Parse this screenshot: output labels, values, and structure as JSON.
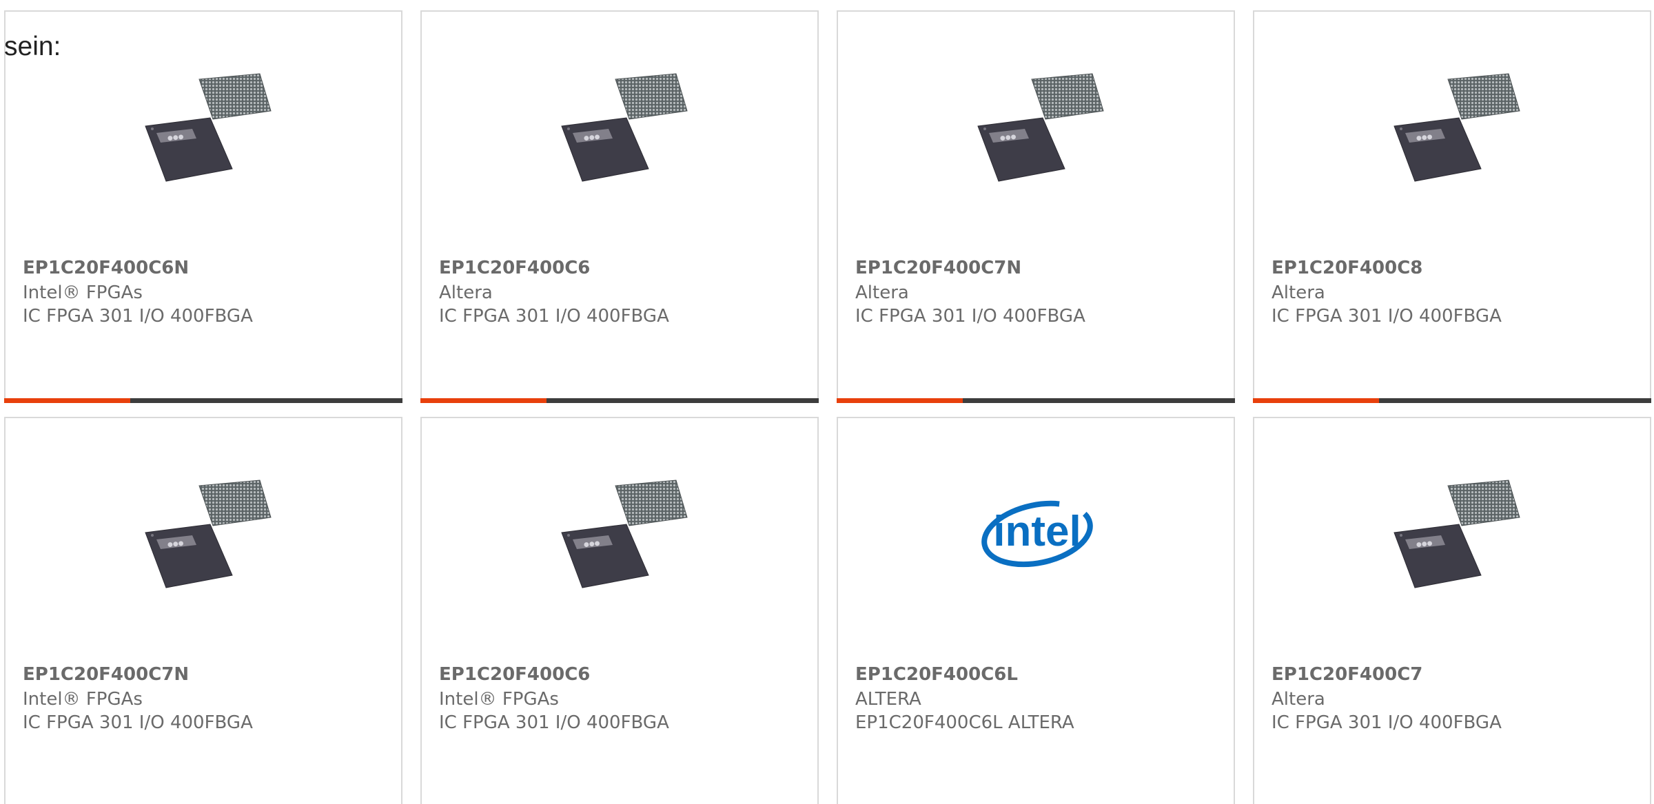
{
  "intro_text": "sein:",
  "accent_color": "#e8400c",
  "products": [
    {
      "part_number": "EP1C20F400C6N",
      "manufacturer": "Intel® FPGAs",
      "description": "IC FPGA 301 I/O 400FBGA",
      "image": "fpga-chip-icon"
    },
    {
      "part_number": "EP1C20F400C6",
      "manufacturer": "Altera",
      "description": "IC FPGA 301 I/O 400FBGA",
      "image": "fpga-chip-icon"
    },
    {
      "part_number": "EP1C20F400C7N",
      "manufacturer": "Altera",
      "description": "IC FPGA 301 I/O 400FBGA",
      "image": "fpga-chip-icon"
    },
    {
      "part_number": "EP1C20F400C8",
      "manufacturer": "Altera",
      "description": "IC FPGA 301 I/O 400FBGA",
      "image": "fpga-chip-icon"
    },
    {
      "part_number": "EP1C20F400C7N",
      "manufacturer": "Intel® FPGAs",
      "description": "IC FPGA 301 I/O 400FBGA",
      "image": "fpga-chip-icon"
    },
    {
      "part_number": "EP1C20F400C6",
      "manufacturer": "Intel® FPGAs",
      "description": "IC FPGA 301 I/O 400FBGA",
      "image": "fpga-chip-icon"
    },
    {
      "part_number": "EP1C20F400C6L",
      "manufacturer": "ALTERA",
      "description": "EP1C20F400C6L ALTERA",
      "image": "intel-logo",
      "logo_text": "intel"
    },
    {
      "part_number": "EP1C20F400C7",
      "manufacturer": "Altera",
      "description": "IC FPGA 301 I/O 400FBGA",
      "image": "fpga-chip-icon"
    }
  ]
}
